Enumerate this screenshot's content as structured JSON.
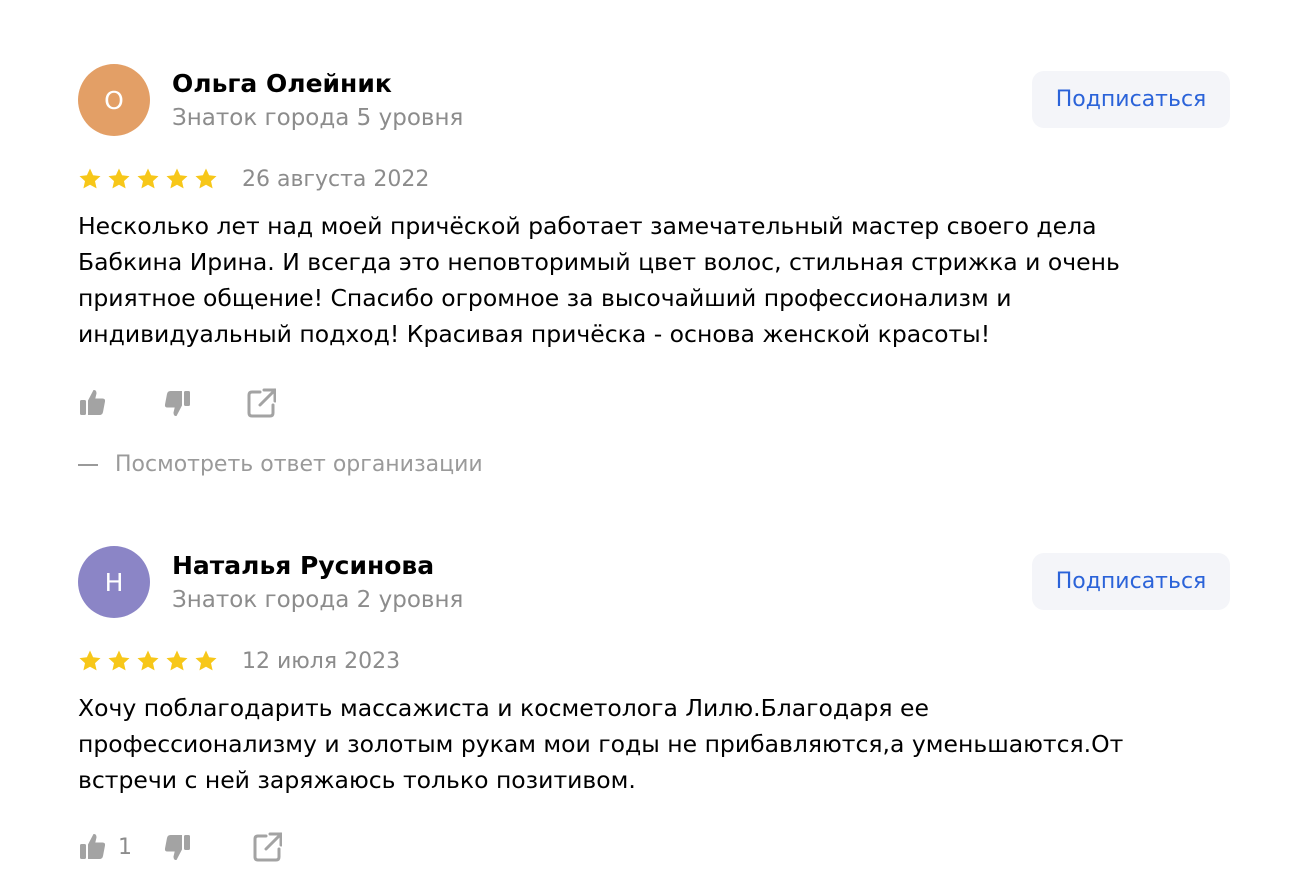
{
  "colors": {
    "star": "#f7c719",
    "muted": "#8c8c8c",
    "link": "#2b63d9",
    "subscribe_bg": "#f4f5f9",
    "icon": "#a3a3a3"
  },
  "reviews": [
    {
      "avatar_letter": "О",
      "avatar_color": "#e39f66",
      "author_name": "Ольга Олейник",
      "author_level": "Знаток города 5 уровня",
      "subscribe_label": "Подписаться",
      "rating": 5,
      "date": "26 августа 2022",
      "text_lines": [
        "Несколько лет над моей причёской работает замечательный мастер своего дела",
        "Бабкина Ирина. И всегда это неповторимый цвет волос, стильная стрижка и очень",
        "приятное общение! Спасибо огромное за высочайший профессионализм и",
        "индивидуальный подход! Красивая причёска - основа женской красоты!"
      ],
      "likes": "",
      "icons": [
        "thumbs-up-icon",
        "thumbs-down-icon",
        "share-icon"
      ],
      "org_reply_label": "Посмотреть ответ организации"
    },
    {
      "avatar_letter": "Н",
      "avatar_color": "#8b85c6",
      "author_name": "Наталья Русинова",
      "author_level": "Знаток города 2 уровня",
      "subscribe_label": "Подписаться",
      "rating": 5,
      "date": "12 июля 2023",
      "text_lines": [
        "Хочу поблагодарить массажиста и косметолога Лилю.Благодаря ее",
        "профессионализму и золотым рукам мои годы не прибавляются,а уменьшаются.От",
        "встречи с ней заряжаюсь только позитивом."
      ],
      "likes": "1",
      "icons": [
        "thumbs-up-icon",
        "thumbs-down-icon",
        "share-icon"
      ]
    }
  ]
}
